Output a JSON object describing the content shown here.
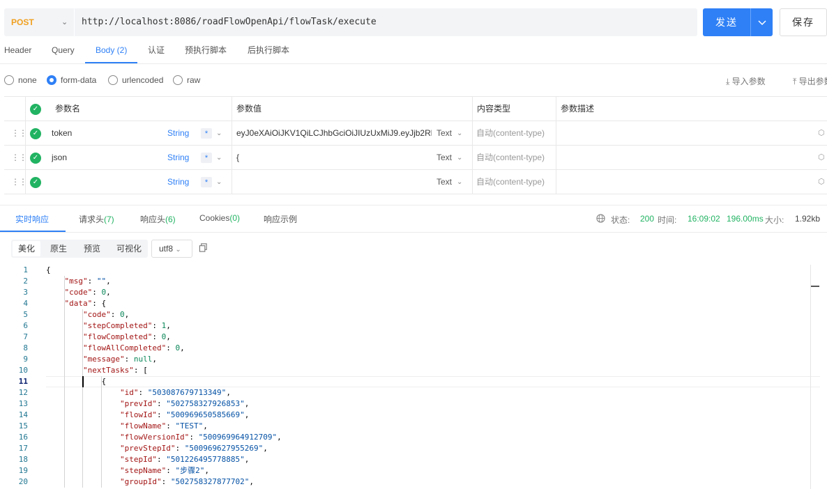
{
  "request": {
    "method": "POST",
    "url_prefix": "http://localhost:8086/",
    "url_path": "roadFlowOpenApi/flowTask/execute",
    "send_label": "发送",
    "save_label": "保存"
  },
  "tabs": [
    "Header",
    "Query",
    "Body (2)",
    "认证",
    "预执行脚本",
    "后执行脚本"
  ],
  "body_types": [
    "none",
    "form-data",
    "urlencoded",
    "raw"
  ],
  "selected_body_type": "form-data",
  "actions": {
    "import": "导入参数",
    "export": "导出参数"
  },
  "params_table": {
    "headers": [
      "参数名",
      "参数值",
      "内容类型",
      "参数描述"
    ],
    "rows": [
      {
        "name": "token",
        "type": "String",
        "required": "*",
        "value": "eyJ0eXAiOiJKV1QiLCJhbGciOiJIUzUxMiJ9.eyJjb2RlIjoi",
        "value_type": "Text",
        "content_type": "自动(content-type)",
        "description": ""
      },
      {
        "name": "json",
        "type": "String",
        "required": "*",
        "value": "{",
        "value_type": "Text",
        "content_type": "自动(content-type)",
        "description": ""
      },
      {
        "name": "",
        "type": "String",
        "required": "*",
        "value": "",
        "value_type": "Text",
        "content_type": "自动(content-type)",
        "description": ""
      }
    ]
  },
  "response_tabs": [
    {
      "label": "实时响应",
      "count": ""
    },
    {
      "label": "请求头",
      "count": "(7)"
    },
    {
      "label": "响应头",
      "count": "(6)"
    },
    {
      "label": "Cookies",
      "count": "(0)"
    },
    {
      "label": "响应示例",
      "count": ""
    }
  ],
  "status": {
    "status_label": "状态:",
    "status_value": "200",
    "time_label": "时间:",
    "time_value": "16:09:02",
    "duration": "196.00ms",
    "size_label": "大小:",
    "size_value": "1.92kb"
  },
  "viewer": {
    "modes": [
      "美化",
      "原生",
      "预览",
      "可视化"
    ],
    "encoding": "utf8"
  },
  "code_lines": [
    "{",
    "    \"msg\": \"\",",
    "    \"code\": 0,",
    "    \"data\": {",
    "        \"code\": 0,",
    "        \"stepCompleted\": 1,",
    "        \"flowCompleted\": 0,",
    "        \"flowAllCompleted\": 0,",
    "        \"message\": null,",
    "        \"nextTasks\": [",
    "            {",
    "                \"id\": \"503087679713349\",",
    "                \"prevId\": \"502758327926853\",",
    "                \"flowId\": \"500969650585669\",",
    "                \"flowName\": \"TEST\",",
    "                \"flowVersionId\": \"500969964912709\",",
    "                \"prevStepId\": \"500969627955269\",",
    "                \"stepId\": \"501226495778885\",",
    "                \"stepName\": \"步骤2\",",
    "                \"groupId\": \"502758327877702\","
  ],
  "current_line": 11,
  "colors": {
    "accent": "#2f80f6",
    "success": "#21b362",
    "method": "#f0a020"
  },
  "icons": {
    "check": "check-circle-icon",
    "grip": "drag-handle-icon",
    "cube": "cube-icon",
    "globe": "globe-icon",
    "copy": "copy-icon"
  }
}
